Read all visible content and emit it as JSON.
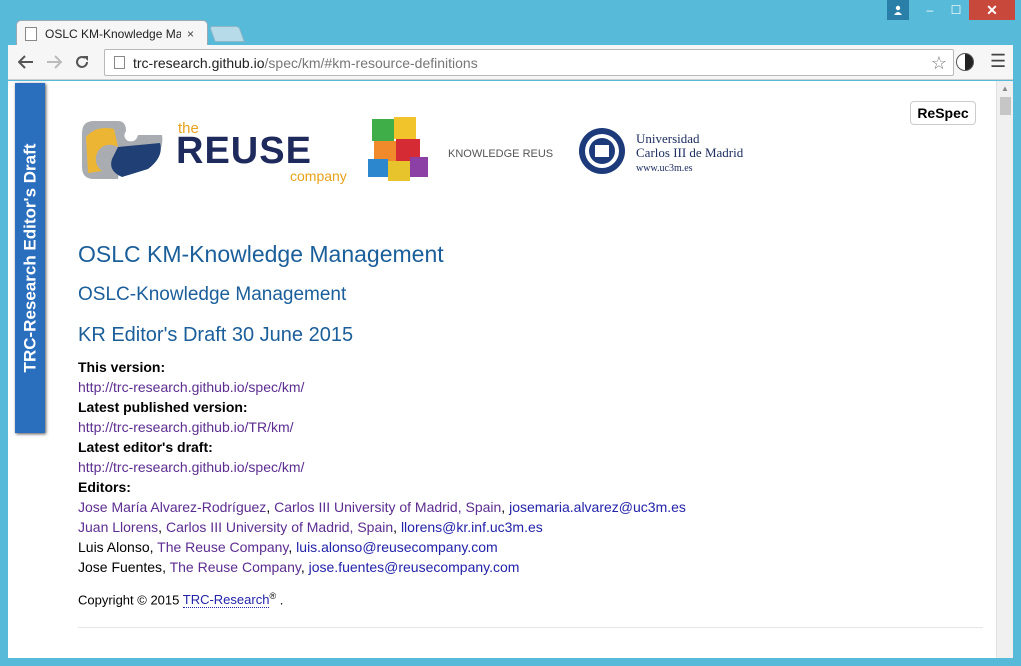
{
  "window": {
    "minimize": "–",
    "maximize": "☐",
    "close": "✕"
  },
  "tab": {
    "title": "OSLC KM-Knowledge Ma",
    "close": "×"
  },
  "address_bar": {
    "host": "trc-research.github.io",
    "path": "/spec/km/#km-resource-definitions"
  },
  "draft_banner": "TRC-Research Editor's Draft",
  "respec_button": "ReSpec",
  "logos": {
    "reuse_the": "the",
    "reuse_main": "REUSE",
    "reuse_company": "company",
    "km_label": "KNOWLEDGE REUSE",
    "uc3m_line1": "Universidad",
    "uc3m_line2": "Carlos III de Madrid",
    "uc3m_line3": "www.uc3m.es"
  },
  "headings": {
    "title": "OSLC KM-Knowledge Management",
    "subtitle": "OSLC-Knowledge Management",
    "status": "KR Editor's Draft 30 June 2015"
  },
  "meta": {
    "this_version_label": "This version:",
    "this_version_url": "http://trc-research.github.io/spec/km/",
    "latest_published_label": "Latest published version:",
    "latest_published_url": "http://trc-research.github.io/TR/km/",
    "latest_editors_label": "Latest editor's draft:",
    "latest_editors_url": "http://trc-research.github.io/spec/km/",
    "editors_label": "Editors:"
  },
  "editors": [
    {
      "name": "Jose María Alvarez-Rodríguez",
      "sep1": ", ",
      "affiliation": "Carlos III University of Madrid, Spain",
      "sep2": ", ",
      "email": "josemaria.alvarez@uc3m.es"
    },
    {
      "name": "Juan Llorens",
      "sep1": ", ",
      "affiliation": "Carlos III University of Madrid, Spain",
      "sep2": ", ",
      "email": "llorens@kr.inf.uc3m.es"
    },
    {
      "name": "Luis Alonso",
      "sep1": ", ",
      "affiliation": "The Reuse Company",
      "sep2": ", ",
      "email": "luis.alonso@reusecompany.com"
    },
    {
      "name": "Jose Fuentes",
      "sep1": ", ",
      "affiliation": "The Reuse Company",
      "sep2": ", ",
      "email": "jose.fuentes@reusecompany.com"
    }
  ],
  "copyright": {
    "prefix": "Copyright © 2015 ",
    "link": "TRC-Research",
    "reg": "®",
    "suffix": " ."
  }
}
